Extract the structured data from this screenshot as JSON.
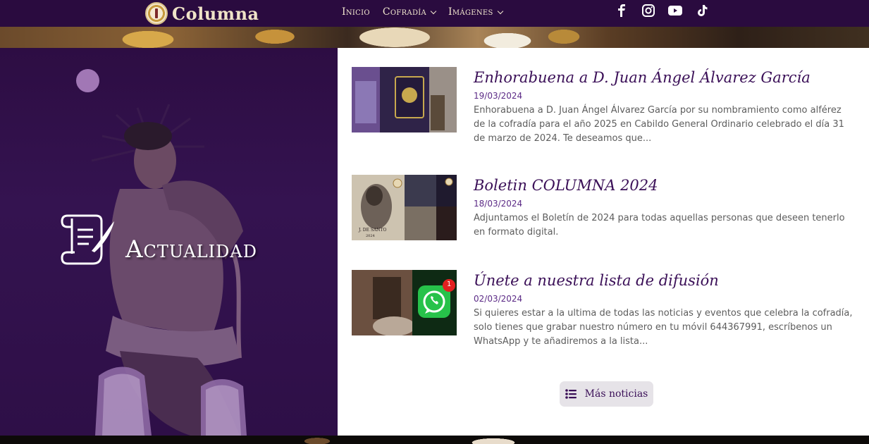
{
  "header": {
    "logo_text": "Columna",
    "nav": [
      {
        "label": "Inicio",
        "has_dropdown": false
      },
      {
        "label": "Cofradía",
        "has_dropdown": true
      },
      {
        "label": "Imágenes",
        "has_dropdown": true
      }
    ],
    "social_icons": [
      "facebook-icon",
      "instagram-icon",
      "youtube-icon",
      "tiktok-icon"
    ]
  },
  "hero": {
    "title": "Actualidad",
    "icon": "scroll-quill-icon"
  },
  "news": [
    {
      "title": "Enhorabuena a D. Juan Ángel Álvarez García",
      "date": "19/03/2024",
      "excerpt": "Enhorabuena a D. Juan Ángel Álvarez García por su nombramiento como alférez de la cofradía para el año 2025 en Cabildo General Ordinario celebrado el día 31 de marzo de 2024. Te deseamos que..."
    },
    {
      "title": "Boletin COLUMNA 2024",
      "date": "18/03/2024",
      "excerpt": "Adjuntamos el Boletín de 2024 para todas aquellas personas que deseen tenerlo en formato digital.",
      "thumb_caption": "J. DE SANTO",
      "thumb_year": "2024"
    },
    {
      "title": "Únete a nuestra lista de difusión",
      "date": "02/03/2024",
      "excerpt": "Si quieres estar a la ultima de todas las noticias y eventos que celebra la cofradía, solo tienes que grabar nuestro número en tu móvil 644367991, escríbenos un WhatsApp y te añadiremos a la lista...",
      "thumb_badge": "1"
    }
  ],
  "more_button": {
    "label": "Más noticias",
    "icon": "list-icon"
  },
  "colors": {
    "header_bg": "#2a0b3f",
    "hero_bg": "#2d0d43",
    "title": "#3a0f57",
    "date": "#5b2a86"
  }
}
